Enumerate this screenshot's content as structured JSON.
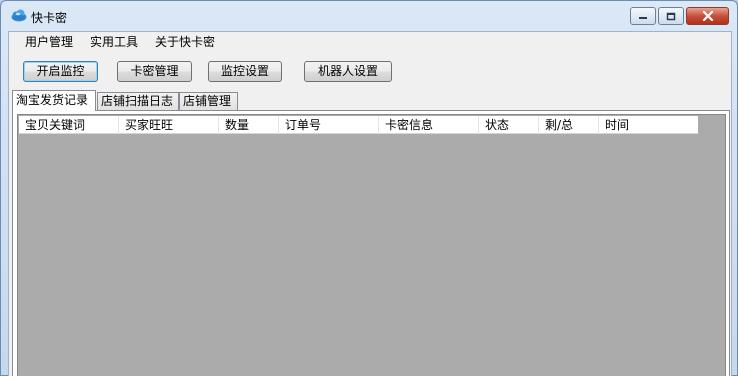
{
  "window": {
    "title": "快卡密",
    "accent": "#6d8bb3"
  },
  "menubar": {
    "items": [
      "用户管理",
      "实用工具",
      "关于快卡密"
    ]
  },
  "toolbar": {
    "start_monitor": "开启监控",
    "card_manage": "卡密管理",
    "monitor_settings": "监控设置",
    "robot_settings": "机器人设置"
  },
  "tabs": [
    {
      "label": "淘宝发货记录",
      "active": true
    },
    {
      "label": "店铺扫描日志",
      "active": false
    },
    {
      "label": "店铺管理",
      "active": false
    }
  ],
  "table": {
    "columns": [
      "宝贝关键词",
      "买家旺旺",
      "数量",
      "订单号",
      "卡密信息",
      "状态",
      "剩/总",
      "时间"
    ],
    "rows": []
  }
}
